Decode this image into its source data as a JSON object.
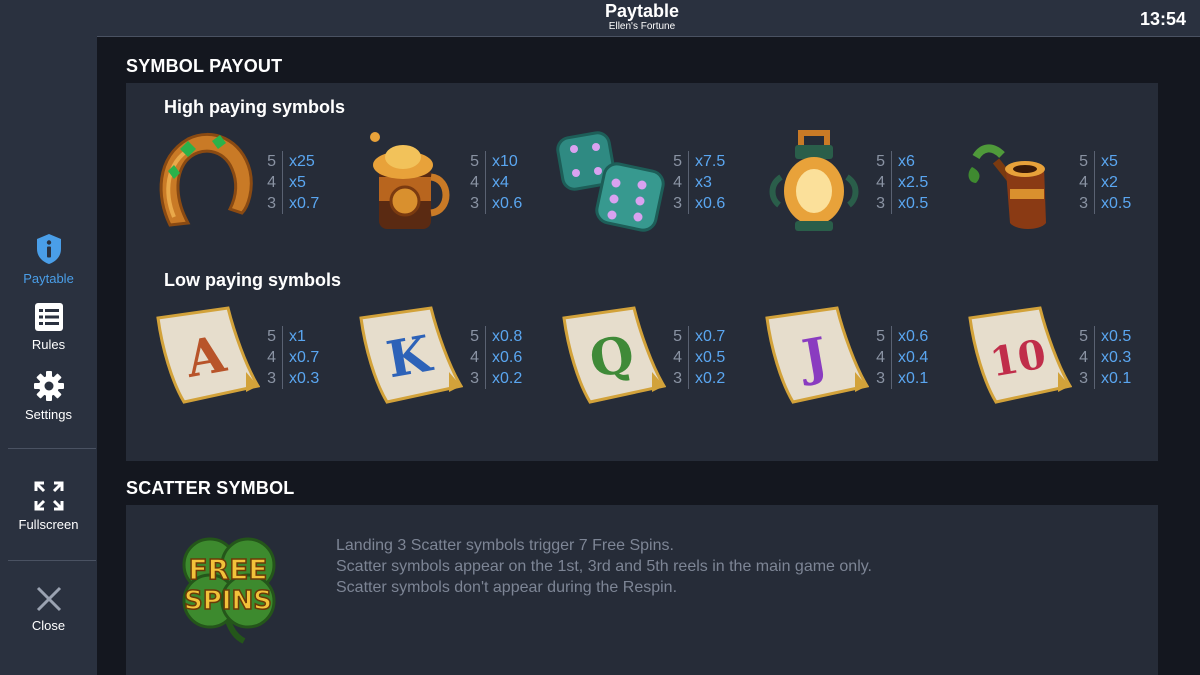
{
  "header": {
    "title": "Paytable",
    "subtitle": "Ellen's Fortune",
    "clock": "13:54"
  },
  "sidebar": {
    "items": [
      {
        "label": "Paytable",
        "icon": "info-shield-icon",
        "active": true
      },
      {
        "label": "Rules",
        "icon": "list-icon"
      },
      {
        "label": "Settings",
        "icon": "gear-icon"
      },
      {
        "label": "Fullscreen",
        "icon": "fullscreen-icon"
      },
      {
        "label": "Close",
        "icon": "close-icon"
      }
    ]
  },
  "symbol_payout": {
    "title": "SYMBOL PAYOUT",
    "high": {
      "title": "High paying symbols",
      "symbols": [
        {
          "icon": "horseshoe-icon",
          "pays": [
            {
              "count": "5",
              "value": "x25"
            },
            {
              "count": "4",
              "value": "x5"
            },
            {
              "count": "3",
              "value": "x0.7"
            }
          ]
        },
        {
          "icon": "tankard-icon",
          "pays": [
            {
              "count": "5",
              "value": "x10"
            },
            {
              "count": "4",
              "value": "x4"
            },
            {
              "count": "3",
              "value": "x0.6"
            }
          ]
        },
        {
          "icon": "dice-icon",
          "pays": [
            {
              "count": "5",
              "value": "x7.5"
            },
            {
              "count": "4",
              "value": "x3"
            },
            {
              "count": "3",
              "value": "x0.6"
            }
          ]
        },
        {
          "icon": "lantern-icon",
          "pays": [
            {
              "count": "5",
              "value": "x6"
            },
            {
              "count": "4",
              "value": "x2.5"
            },
            {
              "count": "3",
              "value": "x0.5"
            }
          ]
        },
        {
          "icon": "pipe-icon",
          "pays": [
            {
              "count": "5",
              "value": "x5"
            },
            {
              "count": "4",
              "value": "x2"
            },
            {
              "count": "3",
              "value": "x0.5"
            }
          ]
        }
      ]
    },
    "low": {
      "title": "Low paying symbols",
      "symbols": [
        {
          "icon": "scroll-a-icon",
          "letter": "A",
          "color": "#b8542a",
          "pays": [
            {
              "count": "5",
              "value": "x1"
            },
            {
              "count": "4",
              "value": "x0.7"
            },
            {
              "count": "3",
              "value": "x0.3"
            }
          ]
        },
        {
          "icon": "scroll-k-icon",
          "letter": "K",
          "color": "#2d62b8",
          "pays": [
            {
              "count": "5",
              "value": "x0.8"
            },
            {
              "count": "4",
              "value": "x0.6"
            },
            {
              "count": "3",
              "value": "x0.2"
            }
          ]
        },
        {
          "icon": "scroll-q-icon",
          "letter": "Q",
          "color": "#3f8a38",
          "pays": [
            {
              "count": "5",
              "value": "x0.7"
            },
            {
              "count": "4",
              "value": "x0.5"
            },
            {
              "count": "3",
              "value": "x0.2"
            }
          ]
        },
        {
          "icon": "scroll-j-icon",
          "letter": "J",
          "color": "#8a3cc0",
          "pays": [
            {
              "count": "5",
              "value": "x0.6"
            },
            {
              "count": "4",
              "value": "x0.4"
            },
            {
              "count": "3",
              "value": "x0.1"
            }
          ]
        },
        {
          "icon": "scroll-10-icon",
          "letter": "10",
          "color": "#c02d4a",
          "pays": [
            {
              "count": "5",
              "value": "x0.5"
            },
            {
              "count": "4",
              "value": "x0.3"
            },
            {
              "count": "3",
              "value": "x0.1"
            }
          ]
        }
      ]
    }
  },
  "scatter": {
    "title": "SCATTER SYMBOL",
    "badge_line1": "FREE",
    "badge_line2": "SPINS",
    "lines": [
      "Landing 3 Scatter symbols trigger 7 Free Spins.",
      "Scatter symbols appear on the 1st, 3rd and 5th reels in the main game only.",
      "Scatter symbols don't appear during the Respin."
    ]
  },
  "colors": {
    "accent": "#4a9ee8",
    "payout": "#5aa6f0",
    "panel": "#262c38",
    "sidebar": "#2a313f"
  }
}
